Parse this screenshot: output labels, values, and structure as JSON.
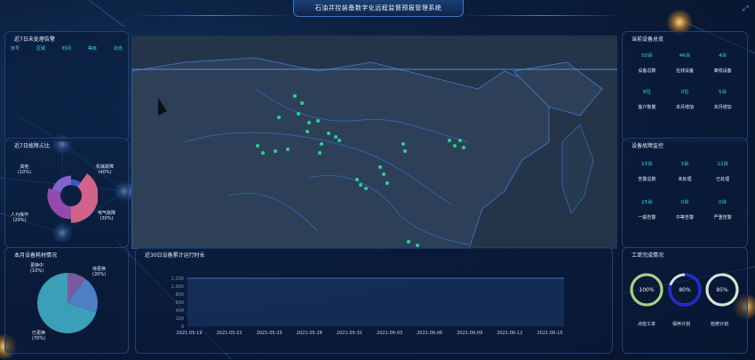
{
  "header": {
    "title": "石油井控装备数字化远程监督预报管理系统"
  },
  "alarms_panel": {
    "title": "近7日未处理告警",
    "columns": [
      "序号",
      "区域",
      "时间",
      "等级",
      "状态"
    ]
  },
  "fault_panel": {
    "title": "近7日故障占比",
    "slices": [
      {
        "label": "其他",
        "pct": "(10%)",
        "value": 10,
        "color": "#3b5fd6"
      },
      {
        "label": "机械故障",
        "pct": "(40%)",
        "value": 40,
        "color": "#e56a8f"
      },
      {
        "label": "电气故障",
        "pct": "(30%)",
        "value": 30,
        "color": "#a24fb8"
      },
      {
        "label": "人为操作",
        "pct": "(20%)",
        "value": 20,
        "color": "#8f6ad8"
      }
    ]
  },
  "material_panel": {
    "title": "本月设备耗材情况",
    "slices": [
      {
        "label": "更换中",
        "pct": "(10%)",
        "value": 10,
        "color": "#7a5a9c"
      },
      {
        "label": "待更换",
        "pct": "(20%)",
        "value": 20,
        "color": "#4f7fc4"
      },
      {
        "label": "已更换",
        "pct": "(70%)",
        "value": 70,
        "color": "#3c9fb8"
      }
    ]
  },
  "device_overview": {
    "title": "当前设备总览",
    "stats": [
      {
        "value": "50台",
        "label": "设备总数"
      },
      {
        "value": "46台",
        "label": "在线设备"
      },
      {
        "value": "4台",
        "label": "离线设备"
      },
      {
        "value": "8位",
        "label": "客户数量"
      },
      {
        "value": "0位",
        "label": "本月增加"
      },
      {
        "value": "5台",
        "label": "本月增加"
      }
    ]
  },
  "fault_monitor": {
    "title": "设备故障监控",
    "stats": [
      {
        "value": "15台",
        "label": "告警总数"
      },
      {
        "value": "3台",
        "label": "未处理"
      },
      {
        "value": "12台",
        "label": "已处理"
      },
      {
        "value": "15台",
        "label": "一般告警"
      },
      {
        "value": "0台",
        "label": "中等告警"
      },
      {
        "value": "0台",
        "label": "严重告警"
      }
    ]
  },
  "work_orders": {
    "title": "工单完成情况",
    "gauges": [
      {
        "value": "100%",
        "label": "点检工单",
        "fraction": 1.0,
        "color": "#a7d27e"
      },
      {
        "value": "80%",
        "label": "保养计划",
        "fraction": 0.8,
        "color": "#1b27e0"
      },
      {
        "value": "85%",
        "label": "检修计划",
        "fraction": 0.85,
        "color": "#d9e6d0"
      }
    ]
  },
  "runtime_chart": {
    "title": "近30日设备累计运行时长",
    "chart_data": {
      "type": "area",
      "title": "近30日设备累计运行时长",
      "x": [
        "2021-05-19",
        "2021-05-22",
        "2021-05-25",
        "2021-05-28",
        "2021-05-31",
        "2021-06-03",
        "2021-06-06",
        "2021-06-09",
        "2021-06-12",
        "2021-06-15"
      ],
      "y_ticks": [
        "0",
        "200",
        "400",
        "600",
        "800",
        "1,000",
        "1,200"
      ],
      "ylim": [
        0,
        1200
      ],
      "series": [
        {
          "values": [
            1200,
            1200,
            1200,
            1200,
            1200,
            1200,
            1200,
            1200,
            1200,
            1200,
            1200,
            1200,
            1200,
            1200,
            1200,
            1200,
            1200,
            1200,
            1200,
            1200,
            1200,
            1200,
            1200,
            1200,
            1200,
            1200,
            1200,
            1200,
            1200,
            1200
          ]
        }
      ]
    }
  }
}
